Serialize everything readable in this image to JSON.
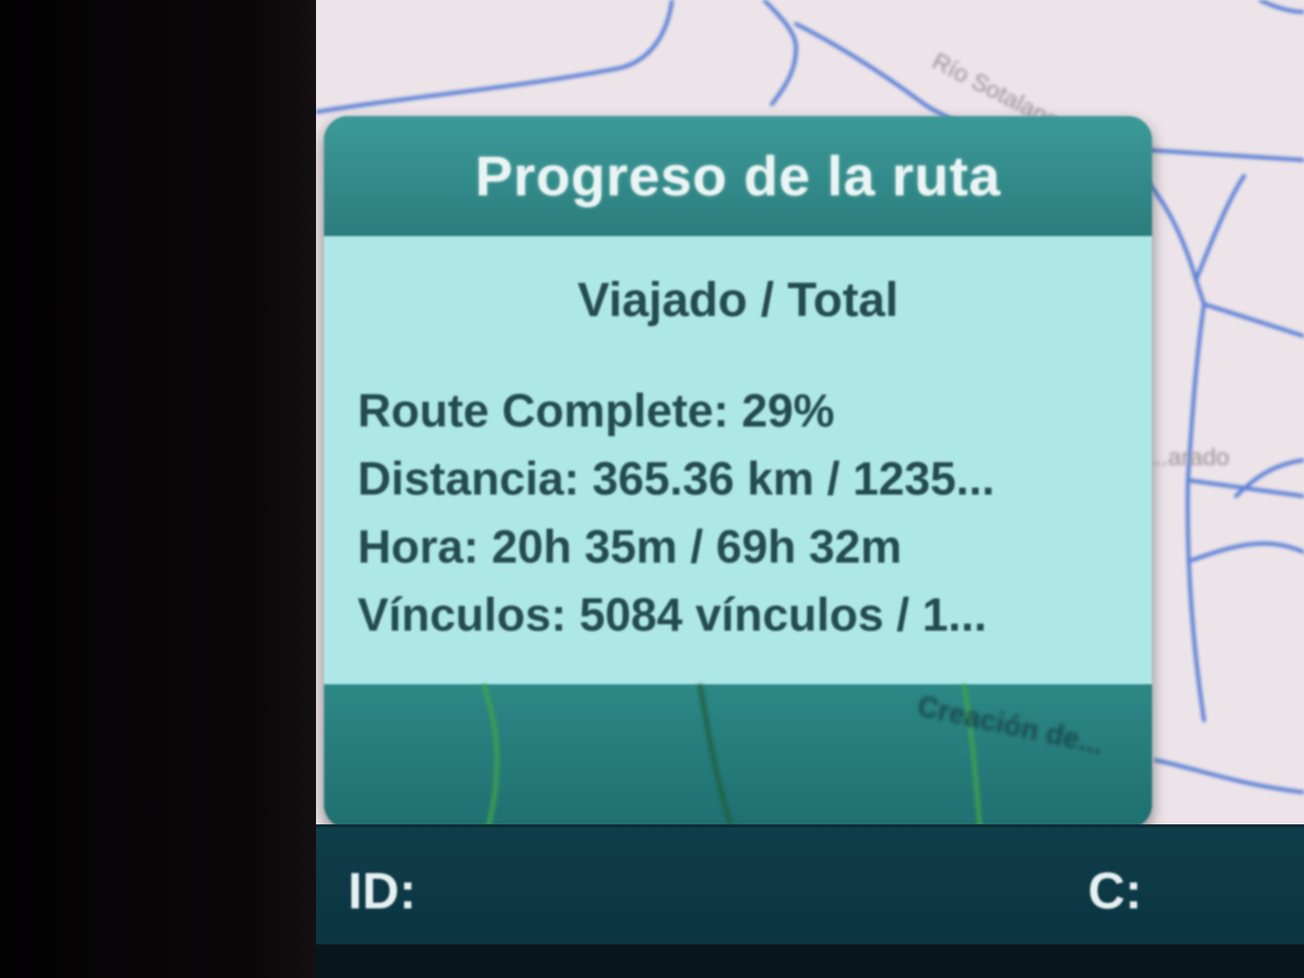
{
  "map": {
    "labels": {
      "river": "Río Sotalanga",
      "town": "...arado"
    }
  },
  "dialog": {
    "title": "Progreso de la ruta",
    "subtitle": "Viajado / Total",
    "rows": [
      "Route Complete: 29%",
      "Distancia: 365.36 km / 1235...",
      "Hora: 20h 35m / 69h 32m",
      "Vínculos: 5084 vínculos / 1..."
    ],
    "footer_label": "Creación de..."
  },
  "statusbar": {
    "id_label": "ID:",
    "c_label": "C:"
  },
  "colors": {
    "dialog_header": "#2a7d7d",
    "dialog_body": "#aee7e7",
    "map_background": "#ece4e8",
    "road": "#5b7fd6",
    "statusbar": "#0b3442"
  }
}
